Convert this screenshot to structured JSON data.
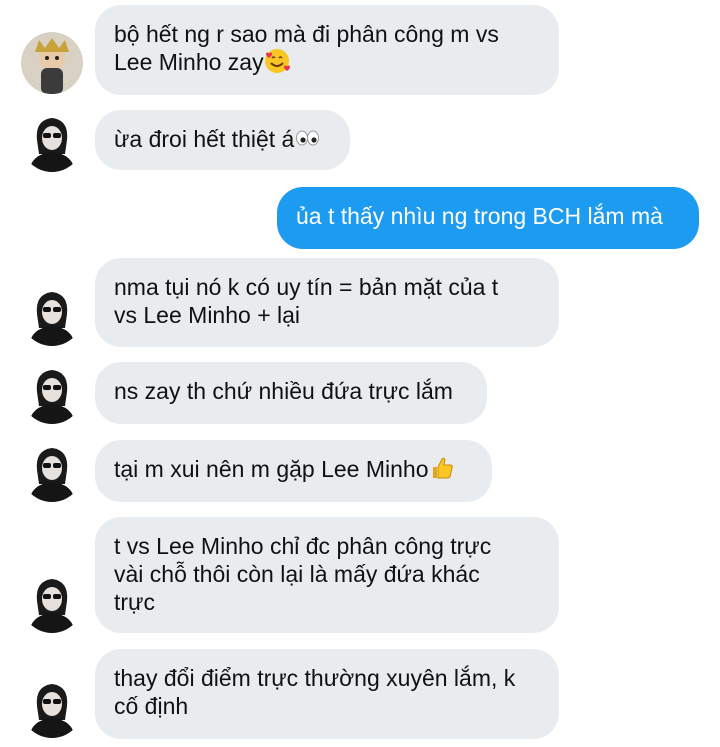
{
  "conversation": {
    "messages": [
      {
        "sender": "friend-a",
        "lines": [
          "bộ hết ng r sao mà đi phân công m vs",
          "Lee Minho zay"
        ],
        "emoji": "smiling-face-with-hearts"
      },
      {
        "sender": "friend-b",
        "lines": [
          "ừa đroi hết thiệt á"
        ],
        "emoji": "eyes"
      },
      {
        "sender": "me",
        "lines": [
          "ủa t thấy nhìu ng trong BCH lắm mà"
        ]
      },
      {
        "sender": "friend-b",
        "lines": [
          "nma tụi nó k có uy tín = bản mặt của t",
          "vs Lee Minho + lại"
        ]
      },
      {
        "sender": "friend-b",
        "lines": [
          "ns zay th chứ nhiều đứa trực lắm"
        ]
      },
      {
        "sender": "friend-b",
        "lines": [
          "tại m xui nên m gặp Lee Minho"
        ],
        "emoji": "thumbs-up"
      },
      {
        "sender": "friend-b",
        "lines": [
          "t vs Lee Minho chỉ đc phân công trực",
          "vài chỗ thôi còn lại là mấy đứa khác",
          "trực"
        ]
      },
      {
        "sender": "friend-b",
        "lines": [
          "thay đổi điểm trực thường xuyên lắm, k",
          "cố định"
        ]
      }
    ]
  },
  "colors": {
    "incoming_bubble": "#e9ecef",
    "outgoing_bubble": "#1d9bf0",
    "incoming_text": "#111111",
    "outgoing_text": "#ffffff"
  }
}
